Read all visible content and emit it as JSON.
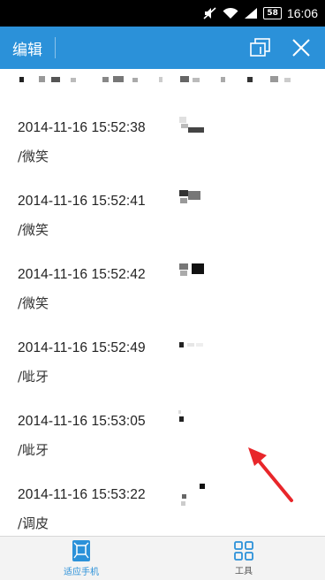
{
  "statusbar": {
    "battery": "58",
    "time": "16:06"
  },
  "appbar": {
    "title": "编辑"
  },
  "messages": [
    {
      "time": "2014-11-16 15:52:38",
      "text": "/微笑"
    },
    {
      "time": "2014-11-16 15:52:41",
      "text": "/微笑"
    },
    {
      "time": "2014-11-16 15:52:42",
      "text": "/微笑"
    },
    {
      "time": "2014-11-16 15:52:49",
      "text": "/呲牙"
    },
    {
      "time": "2014-11-16 15:53:05",
      "text": "/呲牙"
    },
    {
      "time": "2014-11-16 15:53:22",
      "text": "/调皮"
    }
  ],
  "tabs": [
    {
      "label": "适应手机"
    },
    {
      "label": "工具"
    }
  ],
  "colors": {
    "accent": "#2b91d9",
    "arrow": "#e8262a"
  }
}
